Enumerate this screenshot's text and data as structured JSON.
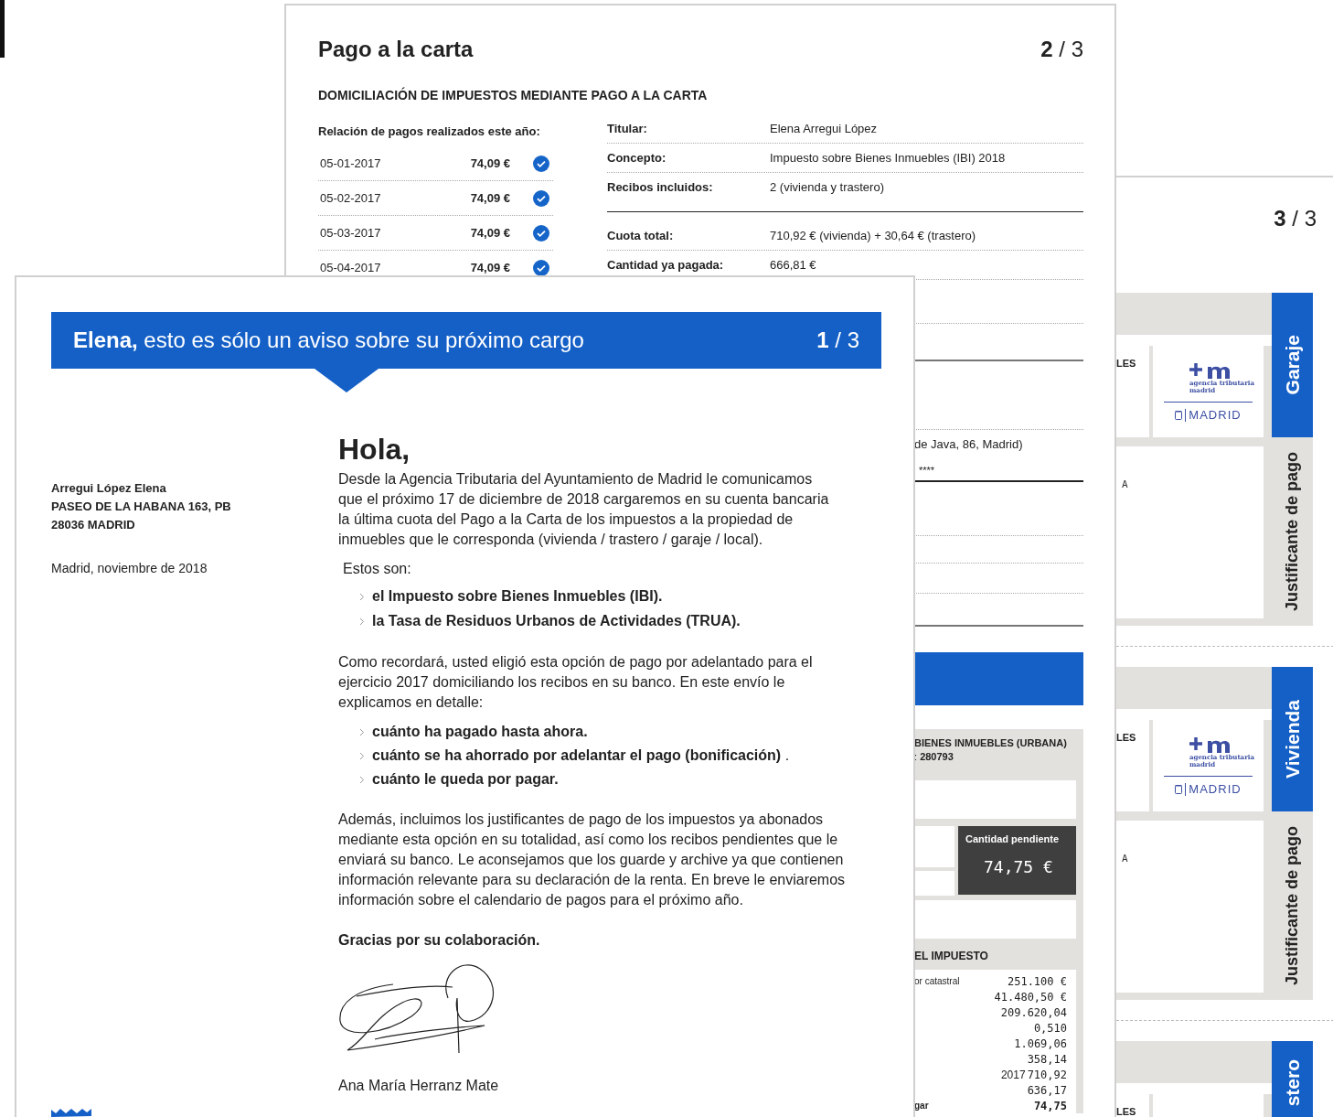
{
  "page_3": {
    "page_number": "**3** / 3",
    "receipts": [
      {
        "tab": "Garaje",
        "side": "Justificante de pago",
        "label": "LES",
        "letter": "A",
        "logo": {
          "line1": "agencia tributaria",
          "line2": "madrid",
          "city": "MADRID"
        }
      },
      {
        "tab": "Vivienda",
        "side": "Justificante de pago",
        "label": "LES",
        "letter": "A",
        "logo": {
          "line1": "agencia tributaria",
          "line2": "madrid",
          "city": "MADRID"
        }
      },
      {
        "tab": "stero",
        "label": "LES"
      }
    ]
  },
  "page_2": {
    "title": "Pago a la carta",
    "page_number": "**2** / 3",
    "heading": "DOMICILIACIÓN DE IMPUESTOS MEDIANTE PAGO A LA CARTA",
    "payments": {
      "title": "Relación de pagos realizados este año:",
      "rows": [
        {
          "date": "05-01-2017",
          "amount": "74,09 €",
          "paid": true
        },
        {
          "date": "05-02-2017",
          "amount": "74,09 €",
          "paid": true
        },
        {
          "date": "05-03-2017",
          "amount": "74,09 €",
          "paid": true
        },
        {
          "date": "05-04-2017",
          "amount": "74,09 €",
          "paid": true
        }
      ]
    },
    "detail_groups": [
      [
        {
          "label": "Titular:",
          "value": "Elena Arregui López"
        },
        {
          "label": "Concepto:",
          "value": "Impuesto sobre Bienes Inmuebles (IBI) 2018"
        },
        {
          "label": "Recibos incluidos:",
          "value": "2 (vivienda y trastero)"
        }
      ],
      [
        {
          "label": "Cuota total:",
          "value": "710,92 € (vivienda) + 30,64 € (trastero)"
        },
        {
          "label": "Cantidad ya pagada:",
          "value": "666,81 €"
        }
      ]
    ],
    "address_fragment": "de Java, 86, Madrid)",
    "account_fragment": "****",
    "receipt": {
      "title": "BIENES INMUEBLES (URBANA)",
      "reference": ": **280793**",
      "pending_label": "Cantidad pendiente",
      "pending_amount": "74,75 €",
      "section_title": "EL IMPUESTO",
      "rows": [
        {
          "kind": "line",
          "label": "or catastral",
          "value": "251.100 €"
        },
        {
          "kind": "line",
          "value": "41.480,50 €"
        },
        {
          "kind": "line",
          "value": "209.620,04"
        },
        {
          "kind": "line",
          "value": "0,510"
        },
        {
          "kind": "line",
          "value": "1.069,06"
        },
        {
          "kind": "line",
          "value": "358,14"
        },
        {
          "kind": "line",
          "prefix": "2017",
          "value": "710,92"
        },
        {
          "kind": "line",
          "value": "636,17"
        },
        {
          "kind": "total",
          "label": "gar",
          "value": "74,75"
        }
      ]
    }
  },
  "page_1": {
    "banner": "**Elena,** esto es sólo un aviso sobre su próximo cargo",
    "page_number": "**1** / 3",
    "recipient": [
      "Arregui López Elena",
      "PASEO DE LA HABANA 163, PB",
      "28036 MADRID"
    ],
    "date": "Madrid, noviembre de 2018",
    "greeting": "Hola,",
    "intro": "Desde la Agencia Tributaria del Ayuntamiento de Madrid le comunicamos que el próximo 17 de diciembre de 2018 cargaremos en su cuenta bancaria la última cuota del Pago a la Carta de los impuestos a la propiedad de inmuebles que le corresponda (vivienda / trastero / garaje / local).",
    "list_intro": "Estos son:",
    "taxes": [
      {
        "text": "el Impuesto sobre Bienes Inmuebles (IBI)."
      },
      {
        "text": "la Tasa de Residuos Urbanos de Actividades (TRUA)."
      }
    ],
    "reminder": "Como recordará, usted eligió esta opción de pago por adelantado para el ejercicio 2017 domiciliando los recibos en su banco. En este envío le explicamos en detalle:",
    "details": [
      {
        "text": "cuánto ha pagado hasta ahora."
      },
      {
        "text": "cuánto se ha ahorrado por adelantar el pago (bonificación)",
        "suffix": " ."
      },
      {
        "text": "cuánto le queda por pagar."
      }
    ],
    "closing": "Además, incluimos los justificantes de pago de los impuestos ya abonados mediante esta opción en su totalidad, así como los recibos pendientes que le enviará su banco. Le aconsejamos que los guarde y archive ya que contienen información relevante para su declaración de la renta. En breve le enviaremos información sobre el calendario de pagos para el próximo año.",
    "thanks": "Gracias por su colaboración.",
    "signer": "Ana María Herranz Mate"
  }
}
